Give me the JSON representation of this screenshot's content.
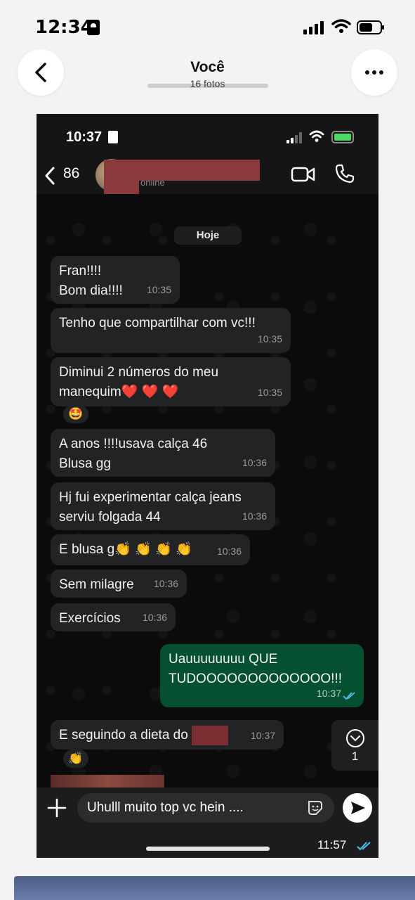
{
  "ios_status": {
    "time": "12:34"
  },
  "viewer": {
    "title": "Você",
    "subtitle": "16 fotos"
  },
  "wa": {
    "status_time": "10:37",
    "back_count": "86",
    "contact_status": "online",
    "date_label": "Hoje",
    "messages": [
      {
        "line1": "Fran!!!!",
        "line2": "Bom dia!!!!",
        "time": "10:35"
      },
      {
        "line1": "Tenho que compartilhar com vc!!!",
        "time": "10:35"
      },
      {
        "line1": "Diminui 2 números do meu",
        "line2": "manequim❤️ ❤️ ❤️",
        "time": "10:35",
        "reaction": "🤩"
      },
      {
        "line1": "A anos !!!!usava calça 46",
        "line2": "Blusa gg",
        "time": "10:36"
      },
      {
        "line1": "Hj fui experimentar calça jeans",
        "line2": "serviu folgada 44",
        "time": "10:36"
      },
      {
        "line1": "E blusa g👏 👏 👏 👏",
        "time": "10:36"
      },
      {
        "line1": "Sem milagre",
        "time": "10:36"
      },
      {
        "line1": "Exercícios",
        "time": "10:36"
      },
      {
        "line1": "Uauuuuuuuu QUE",
        "line2": "TUDOOOOOOOOOOOOO!!!",
        "time": "10:37",
        "outgoing": true
      },
      {
        "line1": "E seguindo a dieta do",
        "time": "10:37",
        "reaction": "👏"
      }
    ],
    "scroll_unread": "1",
    "composer_text": "Uhulll muito top vc hein ....",
    "sent_time": "11:57"
  }
}
